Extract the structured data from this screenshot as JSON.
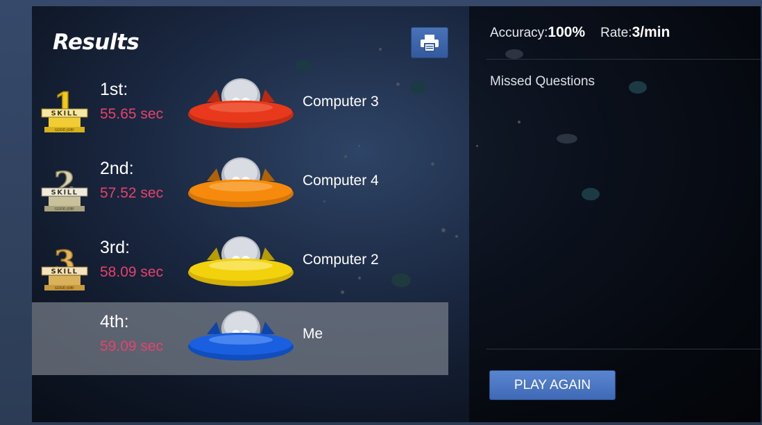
{
  "title": "Results",
  "print_button": {
    "icon": "printer-icon"
  },
  "results": [
    {
      "place": "1st:",
      "time": "55.65 sec",
      "name": "Computer 3",
      "ship_color": "#e8391d",
      "medal_digit": "1",
      "medal_color": "#e8c22a",
      "medal_label": "SKILL",
      "medal_caption": "GOOD JOB!"
    },
    {
      "place": "2nd:",
      "time": "57.52 sec",
      "name": "Computer 4",
      "ship_color": "#f58a0c",
      "medal_digit": "2",
      "medal_color": "#c9c19a",
      "medal_label": "SKILL",
      "medal_caption": "GOOD JOB!"
    },
    {
      "place": "3rd:",
      "time": "58.09 sec",
      "name": "Computer 2",
      "ship_color": "#f2d20c",
      "medal_digit": "3",
      "medal_color": "#d8b15e",
      "medal_label": "SKILL",
      "medal_caption": "GOOD JOB!"
    },
    {
      "place": "4th:",
      "time": "59.09 sec",
      "name": "Me",
      "ship_color": "#1a5fe0"
    }
  ],
  "stats": {
    "accuracy_label": "Accuracy:",
    "accuracy_value": "100%",
    "rate_label": "Rate:",
    "rate_value": "3/min"
  },
  "missed_questions_label": "Missed Questions",
  "play_again_label": "PLAY AGAIN",
  "colors": {
    "time_text": "#e8416b",
    "button_blue": "#4a72b8",
    "highlight_row": "#78808a"
  }
}
